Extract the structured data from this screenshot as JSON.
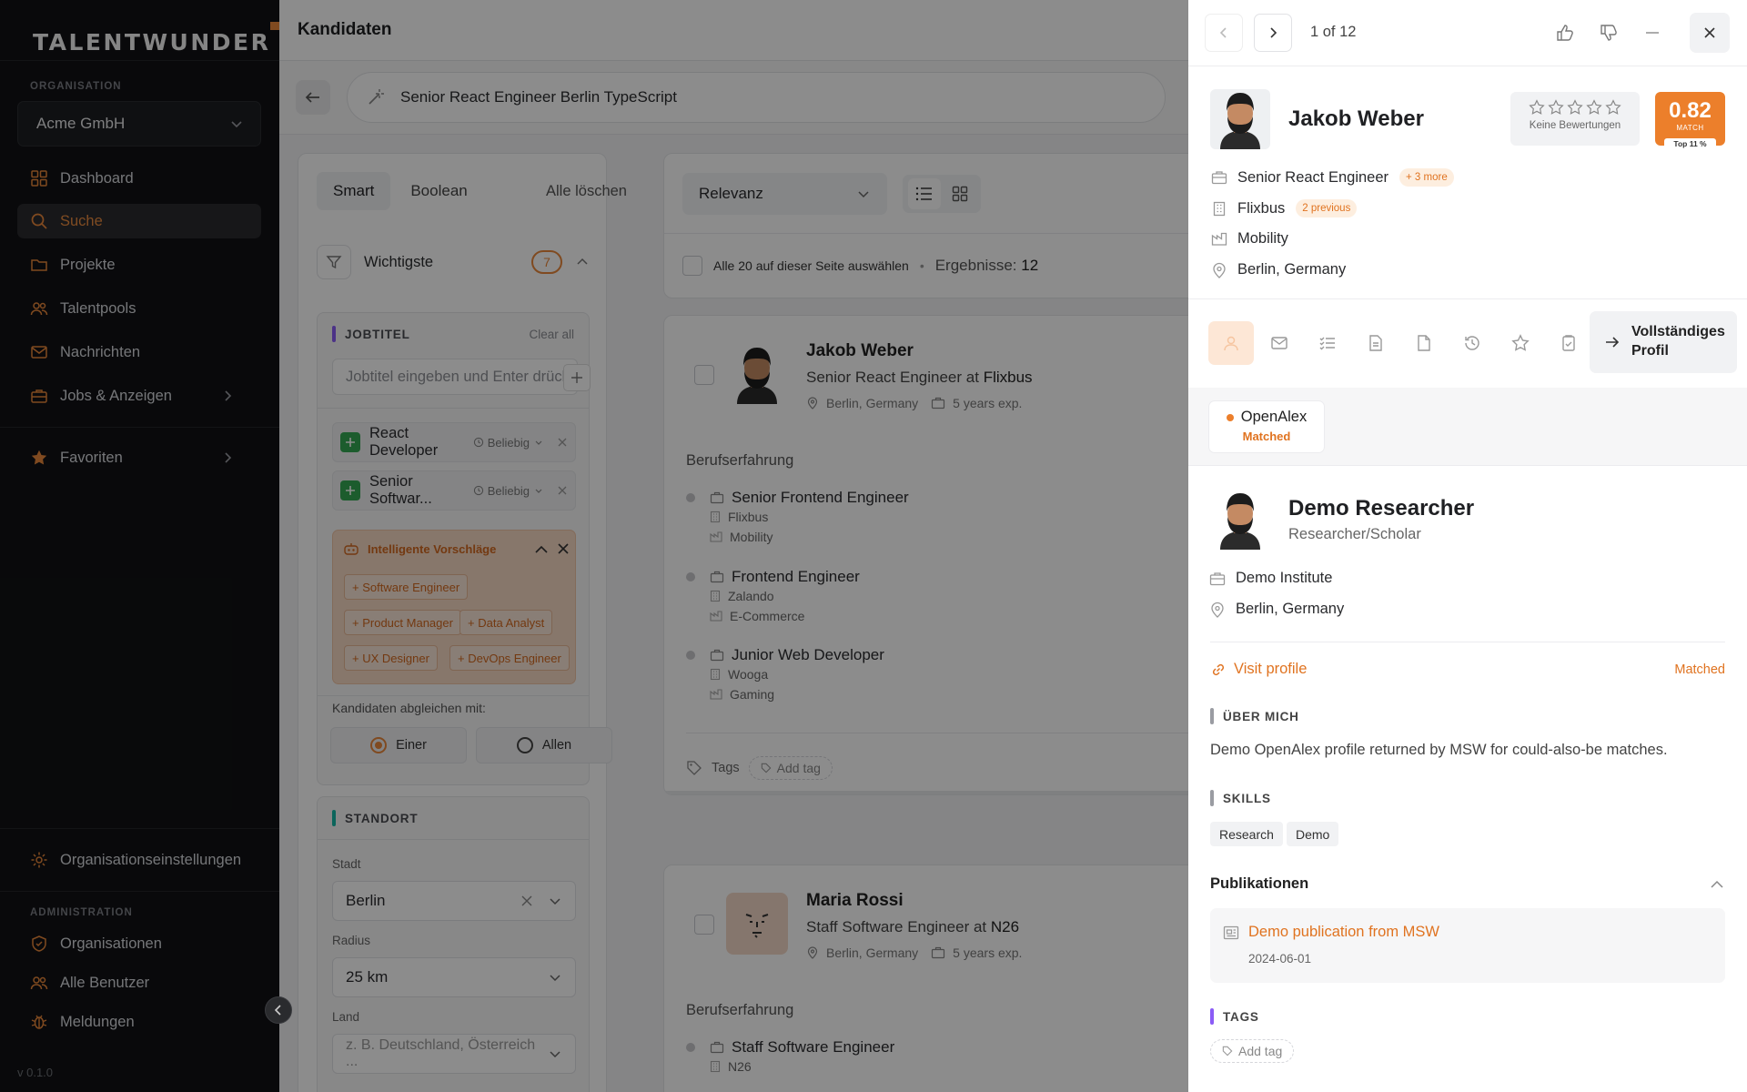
{
  "brand": {
    "logo_text": "TALENTWUNDER",
    "accent": "#E9883B"
  },
  "sidebar": {
    "org_section": "ORGANISATION",
    "org_name": "Acme GmbH",
    "nav": [
      {
        "label": "Dashboard",
        "icon": "dashboard-icon"
      },
      {
        "label": "Suche",
        "icon": "search-icon",
        "active": true
      },
      {
        "label": "Projekte",
        "icon": "folder-icon"
      },
      {
        "label": "Talentpools",
        "icon": "users-icon"
      },
      {
        "label": "Nachrichten",
        "icon": "mail-icon"
      },
      {
        "label": "Jobs & Anzeigen",
        "icon": "briefcase-icon"
      },
      {
        "label": "Favoriten",
        "icon": "star-icon"
      }
    ],
    "org_settings": "Organisationseinstellungen",
    "admin_section": "ADMINISTRATION",
    "admin": [
      {
        "label": "Organisationen",
        "icon": "shield-icon"
      },
      {
        "label": "Alle Benutzer",
        "icon": "users-icon"
      },
      {
        "label": "Meldungen",
        "icon": "bug-icon"
      }
    ],
    "version": "v 0.1.0"
  },
  "main": {
    "title": "Kandidaten",
    "search_query": "Senior React Engineer Berlin TypeScript",
    "filters": {
      "mode_tabs": [
        "Smart",
        "Boolean"
      ],
      "clear_all": "Alle löschen",
      "importance_label": "Wichtigste",
      "importance_count": "7",
      "jobtitle_header": "JOBTITEL",
      "jobtitle_clear": "Clear all",
      "jobtitle_placeholder": "Jobtitel eingeben und Enter drücken",
      "chips": [
        {
          "label": "React Developer",
          "any": "Beliebig"
        },
        {
          "label": "Senior Softwar...",
          "any": "Beliebig"
        }
      ],
      "suggestions_title": "Intelligente Vorschläge",
      "suggestions": [
        "Software Engineer",
        "Product Manager",
        "Data Analyst",
        "UX Designer",
        "DevOps Engineer"
      ],
      "match_label": "Kandidaten abgleichen mit:",
      "match_options": [
        "Einer",
        "Allen"
      ],
      "location_header": "STANDORT",
      "city_label": "Stadt",
      "city_value": "Berlin",
      "radius_label": "Radius",
      "radius_value": "25 km",
      "country_label": "Land",
      "country_placeholder": "z. B. Deutschland, Österreich ..."
    },
    "results": {
      "sort": "Relevanz",
      "select_all": "Alle 20 auf dieser Seite auswählen",
      "results_label": "Ergebnisse:",
      "results_count": "12"
    },
    "candidates": [
      {
        "name": "Jakob Weber",
        "role": "Senior React Engineer at",
        "company": "Flixbus",
        "location": "Berlin, Germany",
        "experience": "5 years exp.",
        "section": "Berufserfahrung",
        "jobs": [
          {
            "title": "Senior Frontend Engineer",
            "company": "Flixbus",
            "industry": "Mobility"
          },
          {
            "title": "Frontend Engineer",
            "company": "Zalando",
            "industry": "E-Commerce"
          },
          {
            "title": "Junior Web Developer",
            "company": "Wooga",
            "industry": "Gaming"
          }
        ],
        "tags_label": "Tags",
        "add_tag": "Add tag"
      },
      {
        "name": "Maria Rossi",
        "role": "Staff Software Engineer at",
        "company": "N26",
        "location": "Berlin, Germany",
        "experience": "5 years exp.",
        "section": "Berufserfahrung",
        "jobs": [
          {
            "title": "Staff Software Engineer",
            "company": "N26"
          }
        ]
      }
    ]
  },
  "drawer": {
    "pager": "1 of 12",
    "profile": {
      "name": "Jakob Weber",
      "rating_label": "Keine Bewertungen",
      "score": "0.82",
      "score_label": "MATCH",
      "score_rank": "Top 11 %",
      "title": "Senior React Engineer",
      "title_more": "+ 3 more",
      "company": "Flixbus",
      "company_more": "2 previous",
      "industry": "Mobility",
      "location": "Berlin, Germany"
    },
    "full_profile": "Vollständiges Profil",
    "source": {
      "name": "OpenAlex",
      "status": "Matched"
    },
    "researcher": {
      "name": "Demo Researcher",
      "subtitle": "Researcher/Scholar",
      "institute": "Demo Institute",
      "location": "Berlin, Germany",
      "visit": "Visit profile",
      "matched": "Matched",
      "about_header": "ÜBER MICH",
      "about": "Demo OpenAlex profile returned by MSW for could-also-be matches.",
      "skills_header": "SKILLS",
      "skills": [
        "Research",
        "Demo"
      ],
      "pubs_header": "Publikationen",
      "pub_title": "Demo publication from MSW",
      "pub_date": "2024-06-01",
      "tags_header": "TAGS",
      "add_tag": "Add tag"
    }
  }
}
